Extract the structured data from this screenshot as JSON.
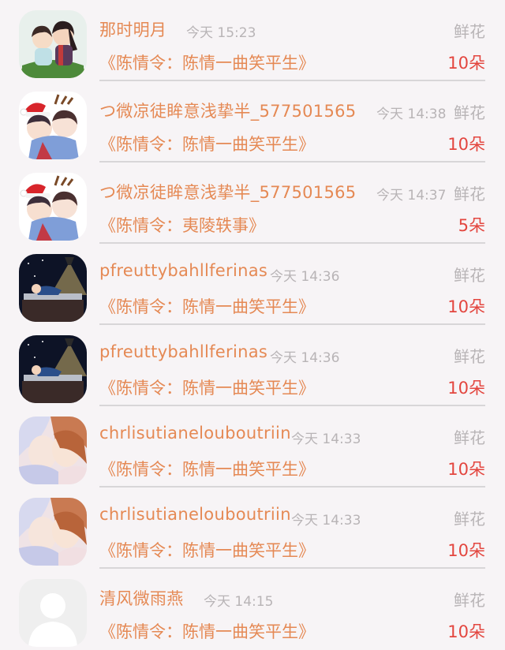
{
  "rows": [
    {
      "name": "那时明月",
      "time": "今天 15:23",
      "gift": "鲜花",
      "drama": "《陈情令：陈情一曲笑平生》",
      "count": "10朵",
      "avatar": "anime-pair"
    },
    {
      "name": "つ微凉徒眸意浅挚半_577501565",
      "time": "今天 14:38",
      "gift": "鲜花",
      "drama": "《陈情令：陈情一曲笑平生》",
      "count": "10朵",
      "avatar": "christmas-anime"
    },
    {
      "name": "つ微凉徒眸意浅挚半_577501565",
      "time": "今天 14:37",
      "gift": "鲜花",
      "drama": "《陈情令：夷陵轶事》",
      "count": "5朵",
      "avatar": "christmas-anime"
    },
    {
      "name": "pfreuttybahllferinas",
      "time": "今天 14:36",
      "gift": "鲜花",
      "drama": "《陈情令：陈情一曲笑平生》",
      "count": "10朵",
      "avatar": "night-lamp"
    },
    {
      "name": "pfreuttybahllferinas",
      "time": "今天 14:36",
      "gift": "鲜花",
      "drama": "《陈情令：陈情一曲笑平生》",
      "count": "10朵",
      "avatar": "night-lamp"
    },
    {
      "name": "chrlisutianelouboutriin",
      "time": "今天 14:33",
      "gift": "鲜花",
      "drama": "《陈情令：陈情一曲笑平生》",
      "count": "10朵",
      "avatar": "anime-kiss"
    },
    {
      "name": "chrlisutianelouboutriin",
      "time": "今天 14:33",
      "gift": "鲜花",
      "drama": "《陈情令：陈情一曲笑平生》",
      "count": "10朵",
      "avatar": "anime-kiss"
    },
    {
      "name": "清风微雨燕",
      "time": "今天 14:15",
      "gift": "鲜花",
      "drama": "《陈情令：陈情一曲笑平生》",
      "count": "10朵",
      "avatar": "default-silhouette"
    }
  ]
}
